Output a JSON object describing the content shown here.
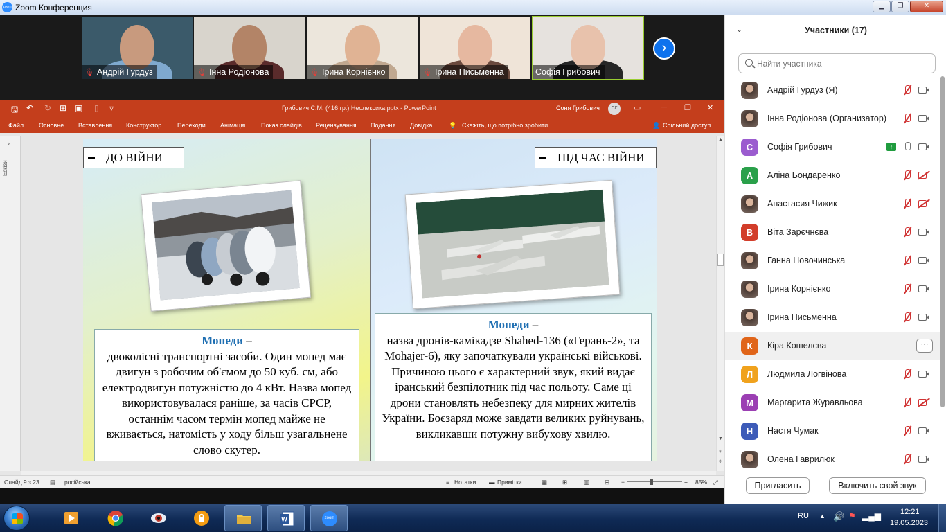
{
  "window": {
    "title": "Zoom Конференция"
  },
  "videos": [
    {
      "name": "Андрій Гурдуз",
      "skin": "#c89a7e",
      "bg": "#3b5a6a",
      "shirt": "#7fa9cf",
      "active": false
    },
    {
      "name": "Інна Родіонова",
      "skin": "#b38467",
      "bg": "#d8d4cc",
      "shirt": "#5a2b2b",
      "active": false
    },
    {
      "name": "Ірина Корнієнко",
      "skin": "#e0b394",
      "bg": "#ece6dc",
      "shirt": "#c0a890",
      "active": false
    },
    {
      "name": "Ірина Письменна",
      "skin": "#e6b8a0",
      "bg": "#efe4d8",
      "shirt": "#6b4a3e",
      "active": false
    },
    {
      "name": "Софія Грибович",
      "skin": "#e8c2ac",
      "bg": "#e6e2de",
      "shirt": "#262626",
      "active": true
    }
  ],
  "ppt": {
    "doc_title": "Грибович С.М. (416 гр.) Неолексика.pptx  -  PowerPoint",
    "user": "Соня Грибович",
    "user_initials": "СГ",
    "menu": [
      "Файл",
      "Основне",
      "Вставлення",
      "Конструктор",
      "Переходи",
      "Анімація",
      "Показ слайдів",
      "Рецензування",
      "Подання",
      "Довідка"
    ],
    "tell_me": "Скажіть, що потрібно зробити",
    "share": "Спільний доступ",
    "panel_label": "Ескізи",
    "status": {
      "slide": "Слайд 9 з 23",
      "lang": "російська",
      "notes": "Нотатки",
      "comments": "Примітки",
      "zoom": "85%"
    }
  },
  "slide": {
    "left_header": "ДО ВІЙНИ",
    "right_header": "ПІД ЧАС ВІЙНИ",
    "left_term": "Мопеди",
    "left_text": "двоколісні транспортні засоби. Один мопед має двигун з робочим об'ємом до 50 куб. см, або електродвигун потужністю до 4 кВт. Назва мопед використовувалася раніше, за часів СРСР, останнім часом термін мопед майже не вживається, натомість у ходу більш узагальнене слово скутер.",
    "right_term": "Мопеди",
    "right_text": "назва дронів-камікадзе Shahed-136 («Герань-2», та Mohajer-6), яку започаткували українські військові. Причиною цього є характерний звук, який видає іранський безпілотник під час польоту. Саме ці дрони становлять небезпеку для мирних жителів України. Боєзаряд може завдати великих руйнувань, викликавши потужну вибухову хвилю."
  },
  "participants_panel": {
    "title": "Участники (17)",
    "search_placeholder": "Найти участника",
    "invite": "Пригласить",
    "unmute": "Включить свой звук",
    "list": [
      {
        "name": "Андрій Гурдуз (Я)",
        "avatar": "photo",
        "color": "",
        "mic": "off",
        "cam": "on"
      },
      {
        "name": "Інна Родіонова (Организатор)",
        "avatar": "photo",
        "color": "",
        "mic": "off",
        "cam": "on"
      },
      {
        "name": "Софія Грибович",
        "avatar": "С",
        "color": "#9b5ccf",
        "mic": "on",
        "cam": "on",
        "share": true
      },
      {
        "name": "Аліна Бондаренко",
        "avatar": "А",
        "color": "#2aa04a",
        "mic": "off",
        "cam": "off"
      },
      {
        "name": "Анастасия Чижик",
        "avatar": "photo",
        "color": "",
        "mic": "off",
        "cam": "off"
      },
      {
        "name": "Віта Зарєчнєва",
        "avatar": "В",
        "color": "#d23d2a",
        "mic": "off",
        "cam": "on"
      },
      {
        "name": "Ганна Новочинська",
        "avatar": "photo",
        "color": "",
        "mic": "off",
        "cam": "on"
      },
      {
        "name": "Ірина Корнієнко",
        "avatar": "photo",
        "color": "",
        "mic": "off",
        "cam": "on"
      },
      {
        "name": "Ірина Письменна",
        "avatar": "photo",
        "color": "",
        "mic": "off",
        "cam": "on"
      },
      {
        "name": "Кіра Кошелєва",
        "avatar": "К",
        "color": "#e0651a",
        "mic": "",
        "cam": "",
        "highlight": true,
        "more": "···"
      },
      {
        "name": "Людмила Логвінова",
        "avatar": "Л",
        "color": "#f0a21d",
        "mic": "off",
        "cam": "on"
      },
      {
        "name": "Маргарита Журавльова",
        "avatar": "М",
        "color": "#9b3fb3",
        "mic": "off",
        "cam": "off"
      },
      {
        "name": "Настя Чумак",
        "avatar": "Н",
        "color": "#3d5bb8",
        "mic": "off",
        "cam": "on"
      },
      {
        "name": "Олена Гаврилюк",
        "avatar": "photo",
        "color": "",
        "mic": "off",
        "cam": "on"
      }
    ]
  },
  "taskbar": {
    "apps": [
      "media-player",
      "chrome",
      "eye-app",
      "vpn-app",
      "file-explorer",
      "word",
      "zoom"
    ],
    "zoom_label": "zoom",
    "lang": "RU",
    "time": "12:21",
    "date": "19.05.2023"
  }
}
